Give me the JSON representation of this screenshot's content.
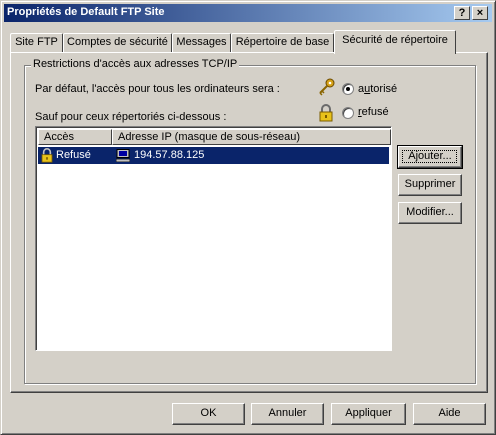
{
  "window": {
    "title": "Propriétés de Default FTP Site",
    "help_button": "?",
    "close_button": "×"
  },
  "tabs": [
    {
      "label": "Site FTP"
    },
    {
      "label": "Comptes de sécurité"
    },
    {
      "label": "Messages"
    },
    {
      "label": "Répertoire de base"
    },
    {
      "label": "Sécurité de répertoire",
      "active": true
    }
  ],
  "group": {
    "title": "Restrictions d'accès aux adresses TCP/IP",
    "default_text": "Par défaut, l'accès pour tous les ordinateurs sera :",
    "radio_granted": {
      "prefix": "a",
      "accel": "u",
      "rest": "torisé",
      "selected": true,
      "icon": "key-icon"
    },
    "radio_denied": {
      "prefix": "",
      "accel": "r",
      "rest": "efusé",
      "selected": false,
      "icon": "lock-icon"
    },
    "except_text": "Sauf pour  ceux répertoriés ci-dessous :"
  },
  "list": {
    "columns": [
      "Accès",
      "Adresse IP (masque de sous-réseau)"
    ],
    "rows": [
      {
        "access": "Refusé",
        "address": "194.57.88.125",
        "access_icon": "lock-icon",
        "address_icon": "computer-icon",
        "selected": true
      }
    ]
  },
  "side_buttons": {
    "add": {
      "label": "Ajouter...",
      "accel": "j"
    },
    "remove": {
      "label": "Supprimer",
      "accel": "S"
    },
    "edit": {
      "label": "Modifier...",
      "accel": "i"
    }
  },
  "footer_buttons": {
    "ok": "OK",
    "cancel": "Annuler",
    "apply": {
      "label": "Appliquer",
      "accel": "A"
    },
    "help": "Aide"
  },
  "colors": {
    "selection": "#0a246a",
    "face": "#d4d0c8",
    "key_gold": "#d4a017"
  }
}
